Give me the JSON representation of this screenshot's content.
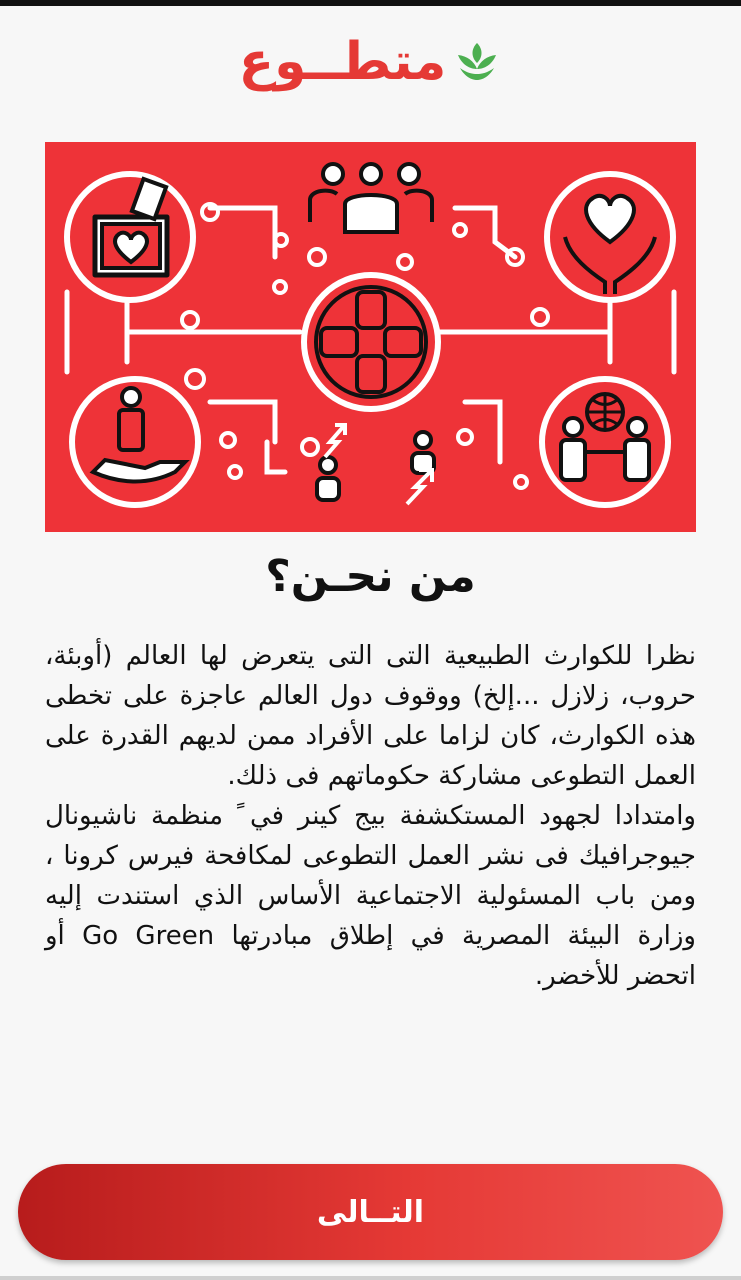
{
  "app": {
    "logo_text": "متطــوع",
    "brand_color": "#e53935",
    "leaf_color": "#4caf50"
  },
  "hero": {
    "background": "#ee3338",
    "icons": [
      "donation-box-icon",
      "group-icon",
      "heart-hands-icon",
      "hands-circle-icon",
      "person-in-hand-icon",
      "globe-people-icon"
    ]
  },
  "content": {
    "title": "من نحـن؟",
    "paragraphs": [
      "نظرا للكوارث الطبيعية التى التى يتعرض لها العالم (أوبئة، حروب، زلازل ...إلخ) ووقوف دول العالم عاجزة على تخطى هذه الكوارث، كان لزاما على الأفراد ممن لديهم القدرة على العمل التطوعى مشاركة حكوماتهم فى ذلك.",
      "وامتدادا لجهود المستكشفة بيج كينر في ً منظمة ناشيونال جيوجرافيك فى نشر العمل التطوعى لمكافحة فيرس كرونا ، ومن باب المسئولية الاجتماعية الأساس الذي استندت إليه وزارة البيئة المصرية في إطلاق مبادرتها Go Green أو اتحضر للأخضر."
    ]
  },
  "footer": {
    "next_label": "التــالى"
  }
}
